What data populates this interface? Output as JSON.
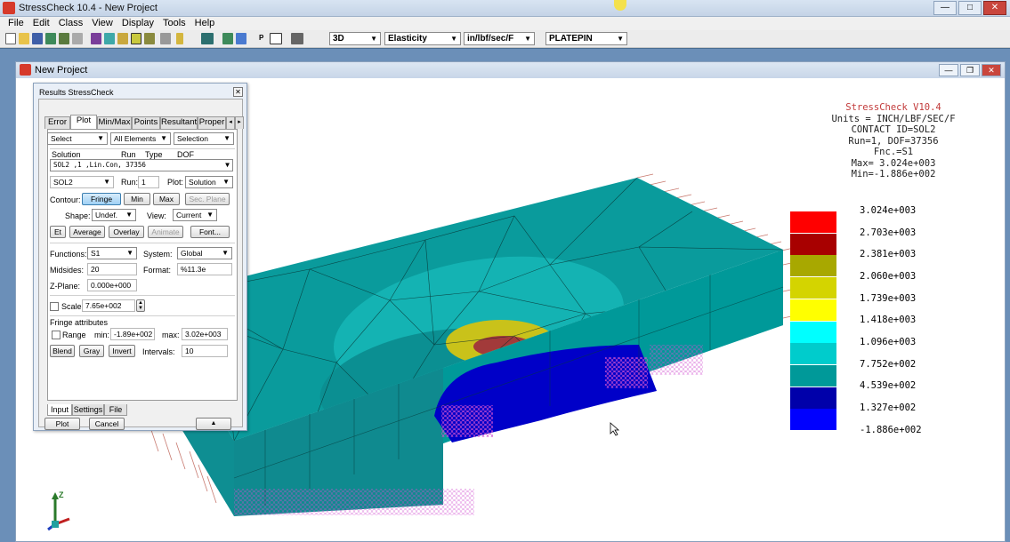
{
  "app": {
    "title": "StressCheck 10.4 - New Project"
  },
  "menu": [
    "File",
    "Edit",
    "Class",
    "View",
    "Display",
    "Tools",
    "Help"
  ],
  "toolbar": {
    "view_mode": "3D",
    "analysis": "Elasticity",
    "units": "in/lbf/sec/F",
    "model": "PLATEPIN",
    "p_label": "P"
  },
  "project_window": {
    "title": "New Project"
  },
  "info": {
    "header": "StressCheck V10.4",
    "lines": [
      "Units = INCH/LBF/SEC/F",
      "CONTACT ID=SOL2",
      "Run=1, DOF=37356",
      "Fnc.=S1",
      "Max= 3.024e+003",
      "Min=-1.886e+002"
    ]
  },
  "legend": {
    "labels": [
      "3.024e+003",
      "2.703e+003",
      "2.381e+003",
      "2.060e+003",
      "1.739e+003",
      "1.418e+003",
      "1.096e+003",
      "7.752e+002",
      "4.539e+002",
      "1.327e+002",
      "-1.886e+002"
    ],
    "colors": [
      "#ff0000",
      "#a80000",
      "#a8a800",
      "#d4d400",
      "#ffff00",
      "#00ffff",
      "#00cccc",
      "#009999",
      "#0000aa",
      "#0000ff"
    ]
  },
  "axes": {
    "z_label": "Z"
  },
  "dialog": {
    "title": "Results StressCheck",
    "tabs": [
      "Error",
      "Plot",
      "Min/Max",
      "Points",
      "Resultant",
      "Proper"
    ],
    "select": "Select",
    "elements": "All Elements",
    "selection": "Selection",
    "sol_headers": [
      "Solution",
      "Run",
      "Type",
      "DOF"
    ],
    "sol_row": "SOL2              ,1 ,Lin.Con, 37356",
    "solution_name": "SOL2",
    "run_label": "Run:",
    "run_value": "1",
    "plot_label": "Plot:",
    "plot_value": "Solution",
    "contour_label": "Contour:",
    "btn_fringe": "Fringe",
    "btn_min": "Min",
    "btn_max": "Max",
    "btn_secplane": "Sec. Plane",
    "shape_label": "Shape:",
    "shape_value": "Undef.",
    "view_label": "View:",
    "view_value": "Current",
    "btn_et": "Et",
    "btn_average": "Average",
    "btn_overlay": "Overlay",
    "btn_animate": "Animate",
    "btn_font": "Font...",
    "functions_label": "Functions:",
    "functions_value": "S1",
    "system_label": "System:",
    "system_value": "Global",
    "midsides_label": "Midsides:",
    "midsides_value": "20",
    "format_label": "Format:",
    "format_value": "%11.3e",
    "zplane_label": "Z-Plane:",
    "zplane_value": "0.000e+000",
    "scale_label": "Scale:",
    "scale_value": "7.65e+002",
    "fringe_attr_label": "Fringe attributes",
    "range_label": "Range",
    "min_label": "min:",
    "min_value": "-1.89e+002",
    "max_label": "max:",
    "max_value": "3.02e+003",
    "btn_blend": "Blend",
    "btn_gray": "Gray",
    "btn_invert": "Invert",
    "intervals_label": "Intervals:",
    "intervals_value": "10",
    "bottom_tabs": [
      "Input",
      "Settings",
      "File"
    ],
    "btn_plot": "Plot",
    "btn_cancel": "Cancel"
  }
}
